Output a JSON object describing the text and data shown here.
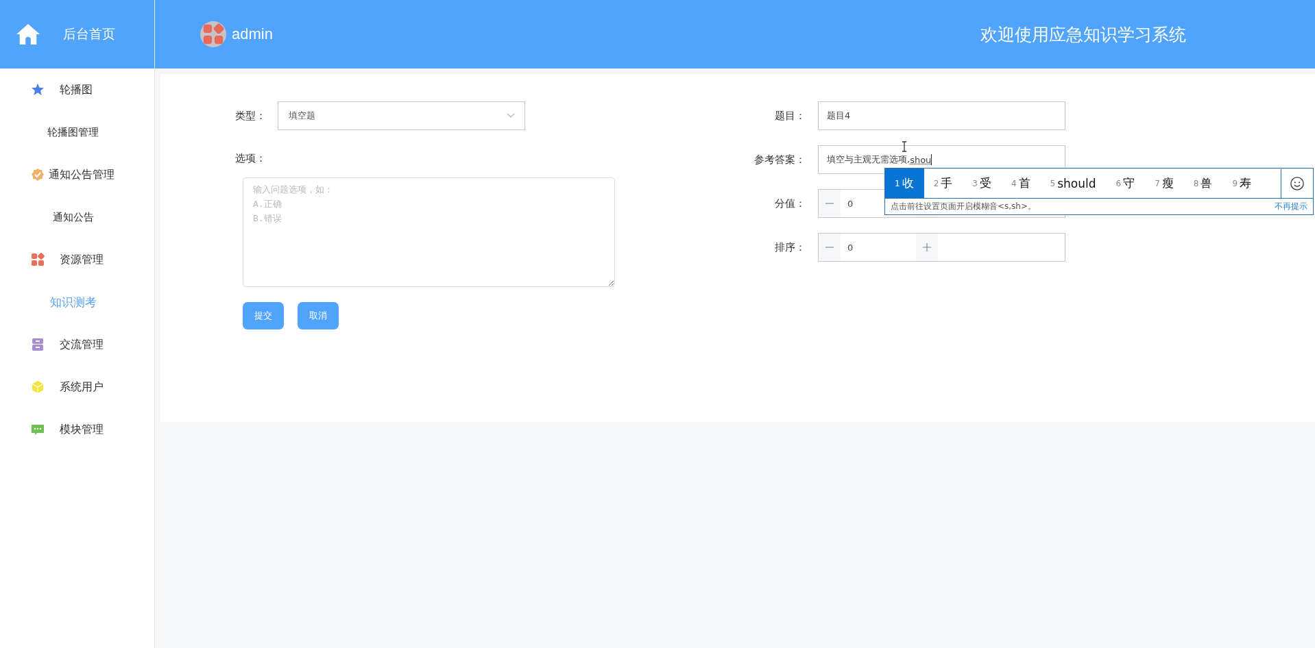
{
  "sidebar": {
    "brand": "后台首页",
    "menus": [
      {
        "title": "轮播图",
        "children": [
          {
            "label": "轮播图管理",
            "selected": false
          }
        ]
      },
      {
        "title": "通知公告管理",
        "children": [
          {
            "label": "通知公告",
            "selected": false
          }
        ]
      },
      {
        "title": "资源管理",
        "children": [
          {
            "label": "知识测考",
            "selected": true
          }
        ]
      },
      {
        "title": "交流管理"
      },
      {
        "title": "系统用户"
      },
      {
        "title": "模块管理"
      }
    ]
  },
  "header": {
    "user": "admin",
    "title": "欢迎使用应急知识学习系统"
  },
  "form": {
    "type": {
      "label": "类型：",
      "value": "填空题"
    },
    "options": {
      "label": "选项：",
      "placeholder": "输入问题选项，如：\nA.正确\nB.错误"
    },
    "buttons": [
      "提交",
      "取消"
    ],
    "question": {
      "label": "题目：",
      "value": "题目4"
    },
    "answer": {
      "label": "参考答案：",
      "value": "填空与主观无需选项,",
      "composition": "shou"
    },
    "score": {
      "label": "分值：",
      "value": "0"
    },
    "order": {
      "label": "排序：",
      "value": "0"
    }
  },
  "ime": {
    "candidates": [
      {
        "index": "1",
        "text": "收",
        "selected": true
      },
      {
        "index": "2",
        "text": "手",
        "selected": false
      },
      {
        "index": "3",
        "text": "受",
        "selected": false
      },
      {
        "index": "4",
        "text": "首",
        "selected": false
      },
      {
        "index": "5",
        "text": "should",
        "selected": false
      },
      {
        "index": "6",
        "text": "守",
        "selected": false
      },
      {
        "index": "7",
        "text": "瘦",
        "selected": false
      },
      {
        "index": "8",
        "text": "兽",
        "selected": false
      },
      {
        "index": "9",
        "text": "寿",
        "selected": false
      }
    ],
    "hint": "点击前往设置页面开启模糊音<s,sh>。",
    "dismiss": "不再提示"
  }
}
